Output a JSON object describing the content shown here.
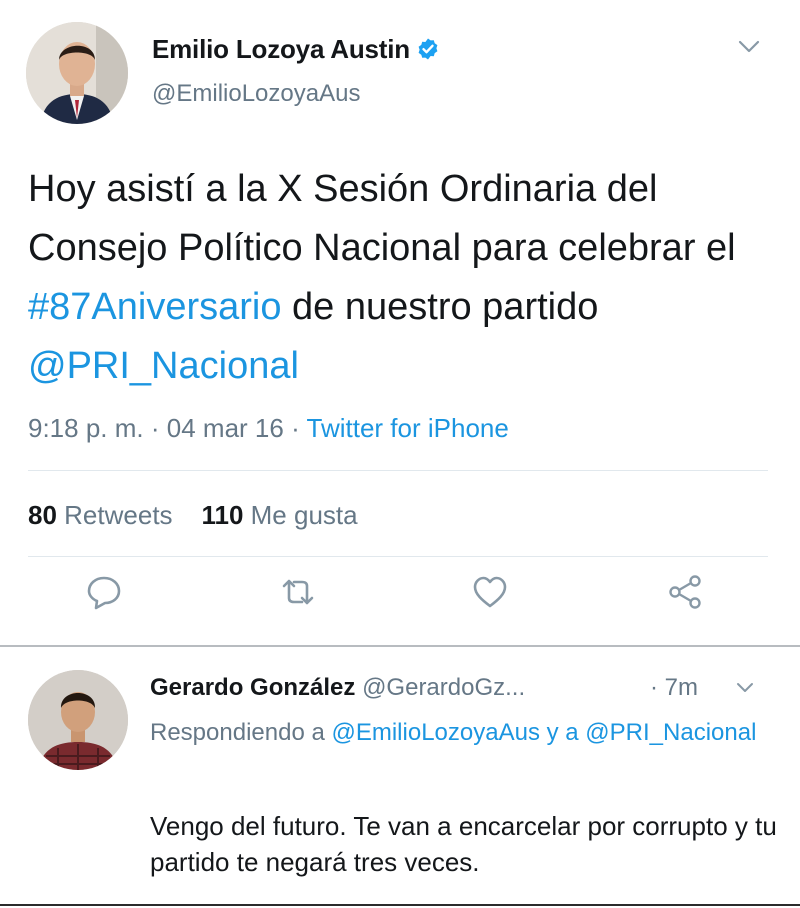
{
  "tweet": {
    "author_name": "Emilio Lozoya Austin",
    "author_handle": "@EmilioLozoyaAus",
    "text_plain_1": "Hoy asistí a la X Sesión Ordinaria del Consejo Político Nacional para celebrar el ",
    "hashtag": "#87Aniversario",
    "text_plain_2": " de nuestro partido ",
    "mention": "@PRI_Nacional",
    "time": "9:18 p. m.",
    "dot1": "·",
    "date": "04 mar 16",
    "dot2": "·",
    "source": "Twitter for iPhone",
    "retweets_count": "80",
    "retweets_label": "Retweets",
    "likes_count": "110",
    "likes_label": "Me gusta",
    "icons": [
      "reply-icon",
      "retweet-icon",
      "like-icon",
      "share-icon"
    ]
  },
  "reply": {
    "author_name": "Gerardo González",
    "author_handle": "@GerardoGz...",
    "time": "· 7m",
    "replying_prefix": "Respondiendo a ",
    "replying_mention_1": "@EmilioLozoyaAus",
    "replying_and": " y a ",
    "replying_mention_2": "@PRI_Nacional",
    "text": "Vengo del futuro. Te van a encarcelar por corrupto y tu partido te negará tres veces."
  },
  "colors": {
    "link": "#1b95e0",
    "muted": "#657786",
    "verified": "#1da1f2"
  }
}
